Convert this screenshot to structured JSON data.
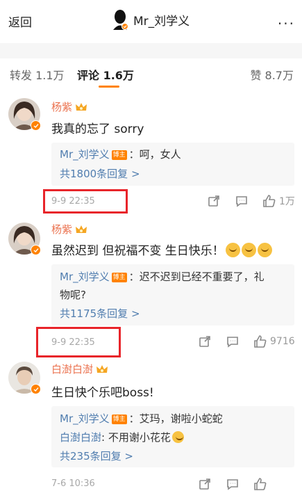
{
  "topbar": {
    "back_label": "返回",
    "title": "Mr_刘学义",
    "more_label": "..."
  },
  "tabs": {
    "repost": "转发 1.1万",
    "comments": "评论 1.6万",
    "likes": "赞 8.7万"
  },
  "author_tag": "博主",
  "comments": [
    {
      "username": "杨紫",
      "content": "我真的忘了 sorry",
      "replies": [
        {
          "name": "Mr_刘学义",
          "is_author": true,
          "text": "：呵，女人"
        }
      ],
      "reply_count": "共1800条回复 >",
      "time": "9-9 22:35",
      "like_count": "1万"
    },
    {
      "username": "杨紫",
      "content": "虽然迟到 但祝福不变 生日快乐！",
      "emoji_count": 3,
      "replies": [
        {
          "name": "Mr_刘学义",
          "is_author": true,
          "text": "：迟不迟到已经不重要了，礼",
          "text2": "物呢?"
        }
      ],
      "reply_count": "共1175条回复 >",
      "time": "9-9 22:35",
      "like_count": "9716"
    },
    {
      "username": "白澍白澍",
      "content": "生日快个乐吧boss!",
      "replies": [
        {
          "name": "Mr_刘学义",
          "is_author": true,
          "text": "：艾玛，谢啦小蛇蛇"
        },
        {
          "name": "白澍白澍",
          "is_author": false,
          "text": ": 不用谢小花花"
        }
      ],
      "reply_count": "共235条回复 >",
      "time": "7-6 10:36"
    }
  ],
  "colors": {
    "accent": "#ff8200",
    "username": "#eb7350",
    "link": "#507daf",
    "highlight_box": "#e8242a"
  }
}
